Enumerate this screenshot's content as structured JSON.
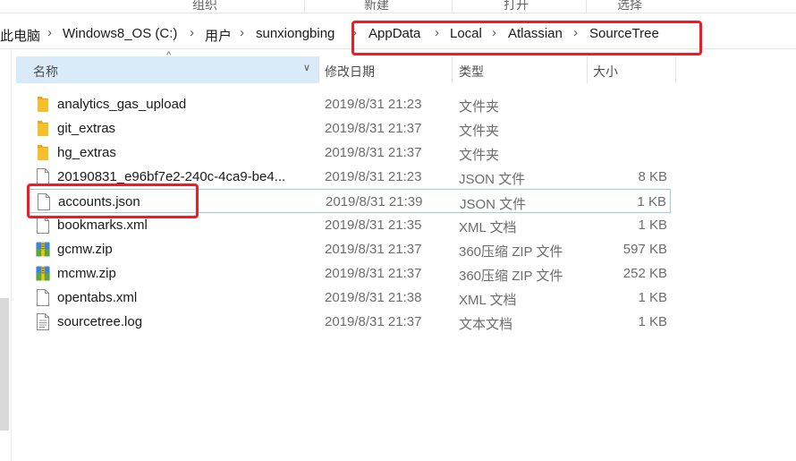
{
  "ribbon": {
    "groups": [
      "组织",
      "新建",
      "打开",
      "选择"
    ]
  },
  "address_bar": {
    "crumbs": [
      "此电脑",
      "Windows8_OS (C:)",
      "用户",
      "sunxiongbing",
      "AppData",
      "Local",
      "Atlassian",
      "SourceTree"
    ]
  },
  "columns": {
    "name": "名称",
    "date": "修改日期",
    "type": "类型",
    "size": "大小"
  },
  "files": [
    {
      "name": "analytics_gas_upload",
      "date": "2019/8/31 21:23",
      "type": "文件夹",
      "size": "",
      "icon": "folder-icon"
    },
    {
      "name": "git_extras",
      "date": "2019/8/31 21:37",
      "type": "文件夹",
      "size": "",
      "icon": "folder-icon"
    },
    {
      "name": "hg_extras",
      "date": "2019/8/31 21:37",
      "type": "文件夹",
      "size": "",
      "icon": "folder-icon"
    },
    {
      "name": "20190831_e96bf7e2-240c-4ca9-be4...",
      "date": "2019/8/31 21:23",
      "type": "JSON 文件",
      "size": "8 KB",
      "icon": "file-icon"
    },
    {
      "name": "accounts.json",
      "date": "2019/8/31 21:39",
      "type": "JSON 文件",
      "size": "1 KB",
      "icon": "file-icon"
    },
    {
      "name": "bookmarks.xml",
      "date": "2019/8/31 21:35",
      "type": "XML 文档",
      "size": "1 KB",
      "icon": "file-icon"
    },
    {
      "name": "gcmw.zip",
      "date": "2019/8/31 21:37",
      "type": "360压缩 ZIP 文件",
      "size": "597 KB",
      "icon": "zip-archive-icon"
    },
    {
      "name": "mcmw.zip",
      "date": "2019/8/31 21:37",
      "type": "360压缩 ZIP 文件",
      "size": "252 KB",
      "icon": "zip-archive-icon"
    },
    {
      "name": "opentabs.xml",
      "date": "2019/8/31 21:38",
      "type": "XML 文档",
      "size": "1 KB",
      "icon": "file-icon"
    },
    {
      "name": "sourcetree.log",
      "date": "2019/8/31 21:37",
      "type": "文本文档",
      "size": "1 KB",
      "icon": "text-document-icon"
    }
  ],
  "colors": {
    "highlight": "#ee1c25",
    "selection_border": "#99c9ef",
    "header_active": "#d9ebf9",
    "folder": "#f5c02b"
  }
}
